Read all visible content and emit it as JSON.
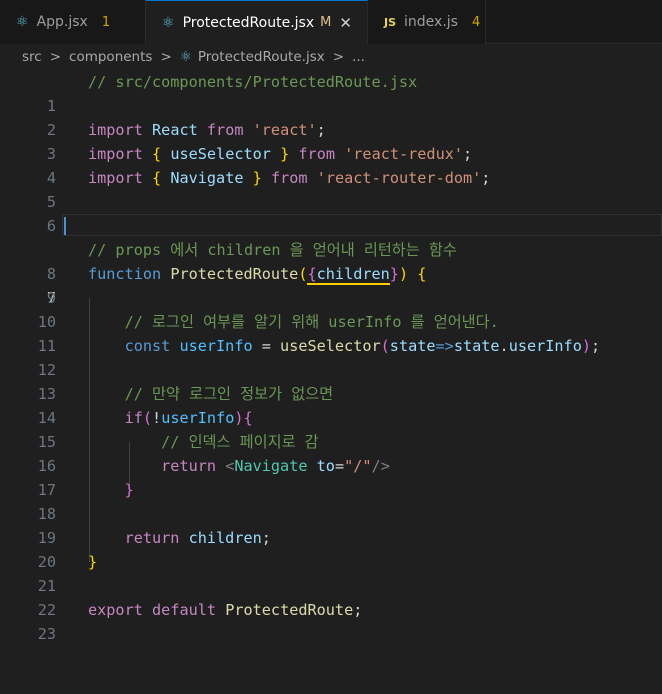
{
  "tabs": [
    {
      "icon": "react-icon",
      "name": "App.jsx",
      "badge": "1",
      "active": false
    },
    {
      "icon": "react-icon",
      "name": "ProtectedRoute.jsx",
      "status": "M",
      "active": true
    },
    {
      "icon": "js-icon",
      "icon_label": "JS",
      "name": "index.js",
      "badge": "4",
      "active": false
    }
  ],
  "breadcrumb": {
    "parts": [
      "src",
      "components",
      "ProtectedRoute.jsx",
      "..."
    ],
    "separator": ">"
  },
  "editor": {
    "current_line": 7,
    "line_numbers": [
      "1",
      "2",
      "3",
      "4",
      "5",
      "6",
      "7",
      "8",
      "9",
      "10",
      "11",
      "12",
      "13",
      "14",
      "15",
      "16",
      "17",
      "18",
      "19",
      "20",
      "21",
      "22",
      "23"
    ],
    "lines": {
      "l1": {
        "comment": "// src/components/ProtectedRoute.jsx"
      },
      "l3": {
        "kw": "import",
        "name": "React",
        "from": "from",
        "src": "'react'",
        "end": ";"
      },
      "l4": {
        "kw": "import",
        "open": "{",
        "name": "useSelector",
        "close": "}",
        "from": "from",
        "src": "'react-redux'",
        "end": ";"
      },
      "l5": {
        "kw": "import",
        "open": "{",
        "name": "Navigate",
        "close": "}",
        "from": "from",
        "src": "'react-router-dom'",
        "end": ";"
      },
      "l8": {
        "comment": "// props 에서 children 을 얻어내 리턴하는 함수"
      },
      "l9": {
        "kw": "function",
        "name": "ProtectedRoute",
        "p1": "(",
        "b1": "{",
        "param": "children",
        "b2": "}",
        "p2": ")",
        "sp": " ",
        "brace": "{"
      },
      "l11": {
        "comment": "// 로그인 여부를 알기 위해 userInfo 를 얻어낸다."
      },
      "l12": {
        "kw": "const",
        "var": "userInfo",
        "eq": " = ",
        "fn": "useSelector",
        "p1": "(",
        "arg": "state",
        "arrow": "=>",
        "obj": "state",
        "dot": ".",
        "prop": "userInfo",
        "p2": ")",
        "end": ";"
      },
      "l14": {
        "comment": "// 만약 로그인 정보가 없으면"
      },
      "l15": {
        "kw": "if",
        "p1": "(",
        "not": "!",
        "var": "userInfo",
        "p2": ")",
        "brace": "{"
      },
      "l16": {
        "comment": "// 인덱스 페이지로 감"
      },
      "l17": {
        "kw": "return",
        "lt": "<",
        "tag": "Navigate",
        "attr": "to",
        "eq": "=",
        "val": "\"/\"",
        "end": "/>"
      },
      "l18": {
        "brace": "}"
      },
      "l20": {
        "kw": "return",
        "var": "children",
        "end": ";"
      },
      "l21": {
        "brace": "}"
      },
      "l23": {
        "kw1": "export",
        "kw2": "default",
        "name": "ProtectedRoute",
        "end": ";"
      }
    }
  }
}
